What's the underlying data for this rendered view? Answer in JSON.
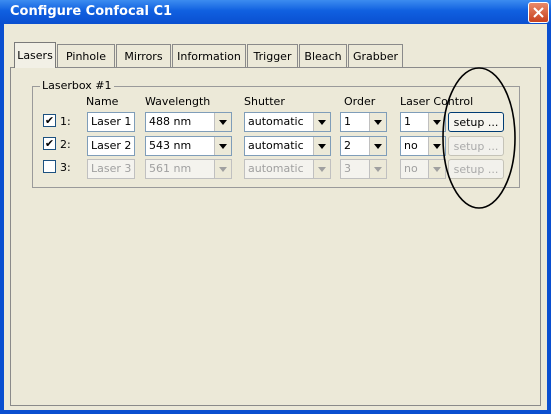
{
  "window": {
    "title": "Configure Confocal C1",
    "close_icon": "close-icon"
  },
  "tabs": [
    {
      "label": "Lasers",
      "active": true
    },
    {
      "label": "Pinhole"
    },
    {
      "label": "Mirrors"
    },
    {
      "label": "Information"
    },
    {
      "label": "Trigger"
    },
    {
      "label": "Bleach"
    },
    {
      "label": "Grabber"
    }
  ],
  "laserbox": {
    "label": "Laserbox #1",
    "headers": {
      "name": "Name",
      "wavelength": "Wavelength",
      "shutter": "Shutter",
      "order": "Order",
      "laser_control": "Laser Control"
    },
    "rows": [
      {
        "num": "1:",
        "checked": true,
        "name": "Laser 1",
        "wavelength": "488 nm",
        "shutter": "automatic",
        "order": "1",
        "control": "1",
        "setup": "setup ...",
        "enabled": true
      },
      {
        "num": "2:",
        "checked": true,
        "name": "Laser 2",
        "wavelength": "543 nm",
        "shutter": "automatic",
        "order": "2",
        "control": "no",
        "setup": "setup ...",
        "enabled": true
      },
      {
        "num": "3:",
        "checked": false,
        "name": "Laser 3",
        "wavelength": "561 nm",
        "shutter": "automatic",
        "order": "3",
        "control": "no",
        "setup": "setup ...",
        "enabled": false
      }
    ]
  },
  "colors": {
    "titlebar": "#0a4fd0",
    "close_button": "#c8411e",
    "dialog_bg": "#ece9d8",
    "annotation": "#000000"
  }
}
